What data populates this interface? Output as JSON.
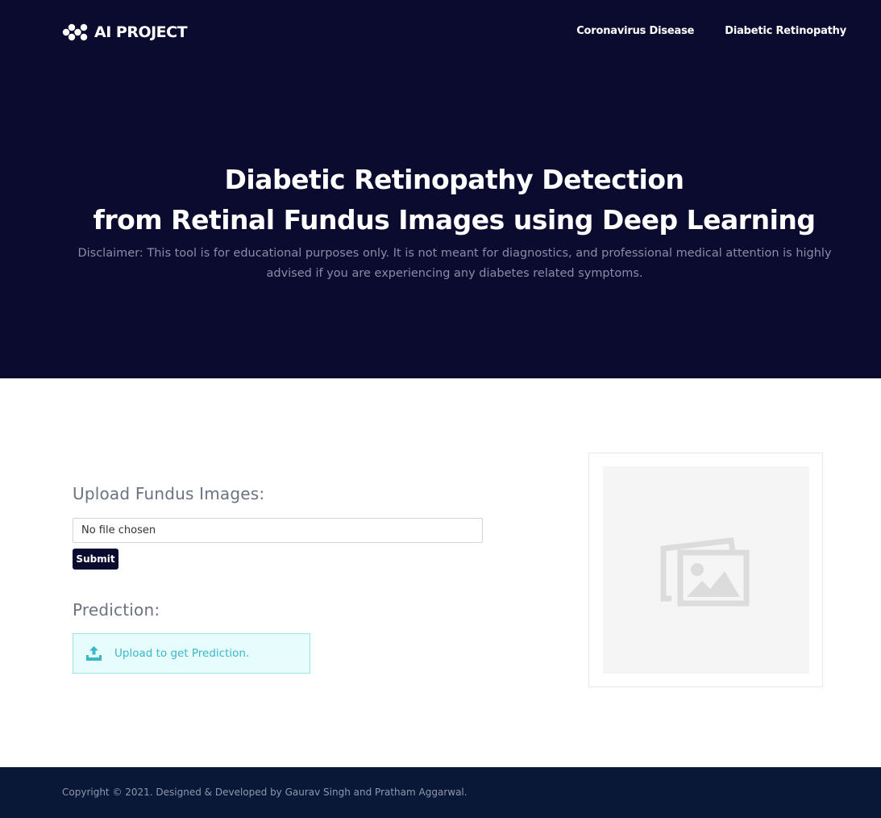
{
  "header": {
    "logo_text": "AI PROJECT",
    "nav": [
      {
        "label": "Coronavirus Disease"
      },
      {
        "label": "Diabetic Retinopathy"
      }
    ]
  },
  "hero": {
    "line1_bold": "Diabetic Retinopathy",
    "line1_rest": " Detection",
    "line2_pre": "from ",
    "line2_bold": "Retinal Fundus Images",
    "line2_rest": " using Deep Learning",
    "disclaimer": "Disclaimer: This tool is for educational purposes only. It is not meant for diagnostics, and professional medical attention is highly advised if you are experiencing any diabetes related symptoms."
  },
  "upload": {
    "heading": "Upload Fundus Images:",
    "file_status": "No file chosen",
    "submit_label": "Submit"
  },
  "prediction": {
    "heading": "Prediction:",
    "message": "Upload to get Prediction.",
    "icon": "upload-icon"
  },
  "preview": {
    "icon": "image-placeholder-icon"
  },
  "footer": {
    "copyright": "Copyright © 2021. Designed & Developed by Gaurav Singh and Pratham Aggarwal."
  },
  "colors": {
    "hero_bg": "#0b0b30",
    "footer_bg": "#0a1838",
    "accent_teal": "#38b8c9",
    "alert_bg": "#e6fcfd"
  }
}
